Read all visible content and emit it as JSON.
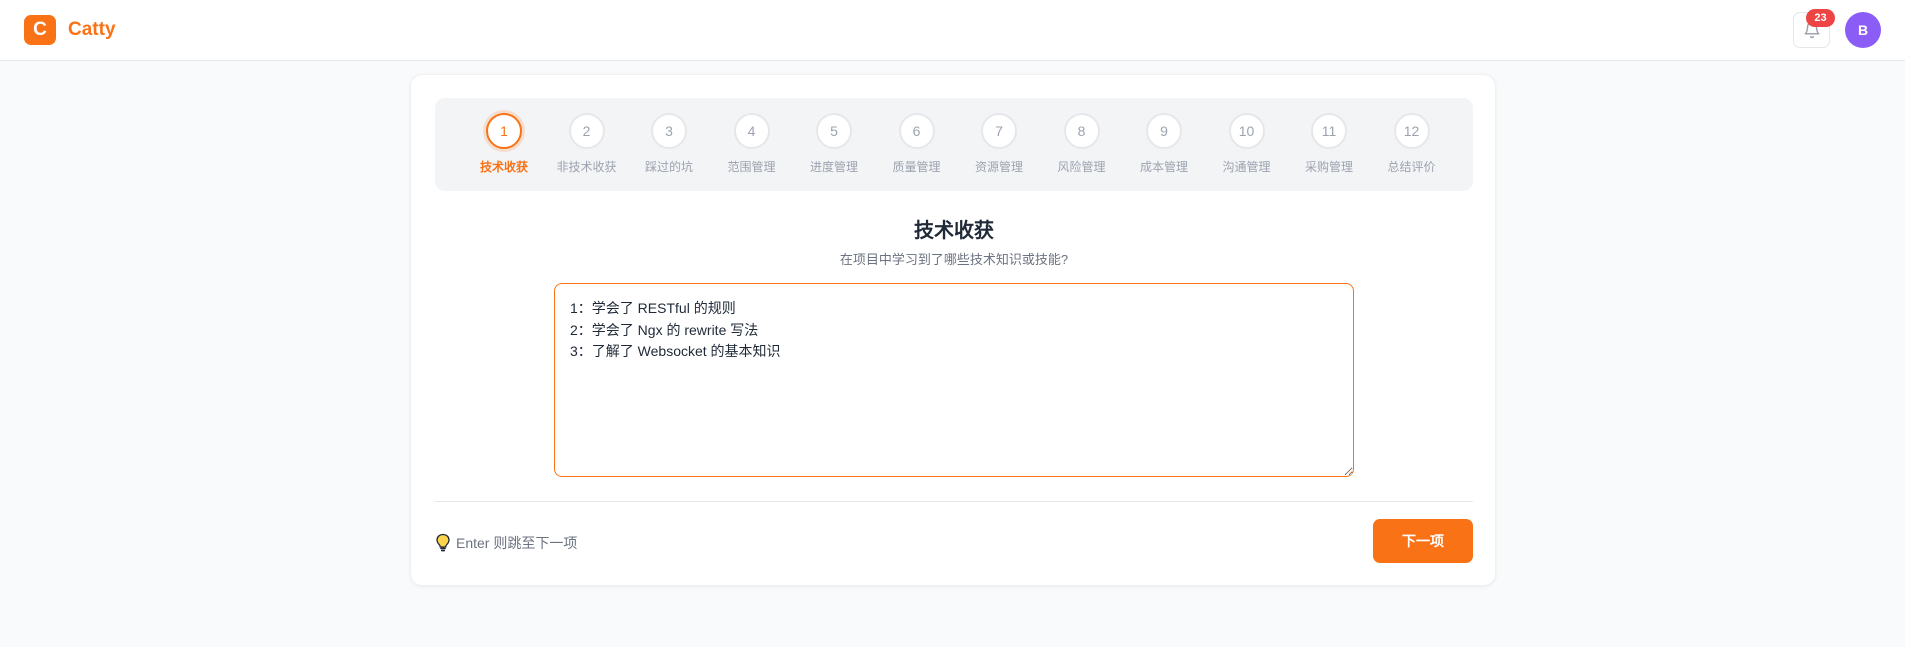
{
  "header": {
    "logo_letter": "C",
    "app_name": "Catty",
    "notification_count": "23",
    "avatar_initial": "B",
    "bell_icon": "bell-icon"
  },
  "colors": {
    "accent": "#f97316",
    "badge": "#ef4444",
    "avatar": "#8b5cf6"
  },
  "stepper": {
    "active_index": 0,
    "steps": [
      {
        "num": "1",
        "label": "技术收获"
      },
      {
        "num": "2",
        "label": "非技术收获"
      },
      {
        "num": "3",
        "label": "踩过的坑"
      },
      {
        "num": "4",
        "label": "范围管理"
      },
      {
        "num": "5",
        "label": "进度管理"
      },
      {
        "num": "6",
        "label": "质量管理"
      },
      {
        "num": "7",
        "label": "资源管理"
      },
      {
        "num": "8",
        "label": "风险管理"
      },
      {
        "num": "9",
        "label": "成本管理"
      },
      {
        "num": "10",
        "label": "沟通管理"
      },
      {
        "num": "11",
        "label": "采购管理"
      },
      {
        "num": "12",
        "label": "总结评价"
      }
    ]
  },
  "question": {
    "title": "技术收获",
    "subtitle": "在项目中学习到了哪些技术知识或技能?",
    "answer": "1：学会了 RESTful 的规则\n2：学会了 Ngx 的 rewrite 写法\n3：了解了 Websocket 的基本知识"
  },
  "footer": {
    "hint_icon": "lightbulb-icon",
    "hint": "Enter 则跳至下一项",
    "next_label": "下一项"
  }
}
